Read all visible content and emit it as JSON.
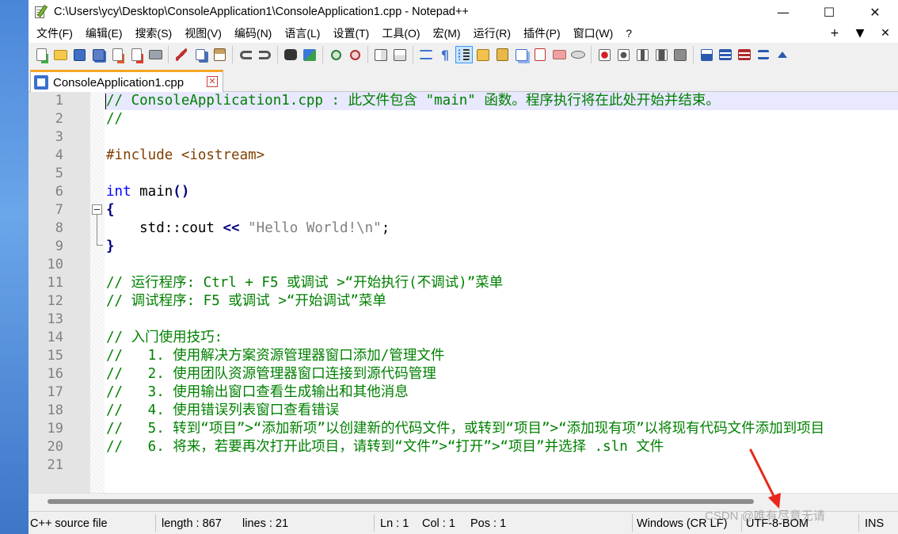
{
  "window": {
    "title": "C:\\Users\\ycy\\Desktop\\ConsoleApplication1\\ConsoleApplication1.cpp - Notepad++",
    "minimize": "—",
    "maximize": "☐",
    "close": "✕"
  },
  "menu": {
    "items": [
      "文件(F)",
      "编辑(E)",
      "搜索(S)",
      "视图(V)",
      "编码(N)",
      "语言(L)",
      "设置(T)",
      "工具(O)",
      "宏(M)",
      "运行(R)",
      "插件(P)",
      "窗口(W)",
      "?"
    ],
    "right": [
      "+",
      "▼",
      "✕"
    ]
  },
  "tab": {
    "label": "ConsoleApplication1.cpp",
    "close": "✕"
  },
  "editor": {
    "line_numbers": [
      "1",
      "2",
      "3",
      "4",
      "5",
      "6",
      "7",
      "8",
      "9",
      "10",
      "11",
      "12",
      "13",
      "14",
      "15",
      "16",
      "17",
      "18",
      "19",
      "20",
      "21"
    ],
    "lines": {
      "l1": "// ConsoleApplication1.cpp : 此文件包含 \"main\" 函数。程序执行将在此处开始并结束。",
      "l2": "//",
      "l4": "#include <iostream>",
      "l6_kw": "int",
      "l6_rest": " main",
      "l6_paren": "()",
      "l7": "{",
      "l8_a": "    std::cout ",
      "l8_op": "<<",
      "l8_str": " \"Hello World!\\n\"",
      "l8_end": ";",
      "l9": "}",
      "l11": "// 运行程序: Ctrl + F5 或调试 >“开始执行(不调试)”菜单",
      "l12": "// 调试程序: F5 或调试 >“开始调试”菜单",
      "l14": "// 入门使用技巧:",
      "l15": "//   1. 使用解决方案资源管理器窗口添加/管理文件",
      "l16": "//   2. 使用团队资源管理器窗口连接到源代码管理",
      "l17": "//   3. 使用输出窗口查看生成输出和其他消息",
      "l18": "//   4. 使用错误列表窗口查看错误",
      "l19": "//   5. 转到“项目”>“添加新项”以创建新的代码文件，或转到“项目”>“添加现有项”以将现有代码文件添加到项目",
      "l20": "//   6. 将来，若要再次打开此项目，请转到“文件”>“打开”>“项目”并选择 .sln 文件"
    }
  },
  "status": {
    "language": "C++ source file",
    "length": "length : 867",
    "lines": "lines : 21",
    "ln": "Ln : 1",
    "col": "Col : 1",
    "pos": "Pos : 1",
    "eol": "Windows (CR LF)",
    "encoding": "UTF-8-BOM",
    "mode": "INS"
  },
  "watermark": "CSDN @唯有尽意无请",
  "colors": {
    "comment": "#008000",
    "keyword": "#0000ff",
    "preprocessor": "#804000",
    "string": "#808080",
    "operator": "#000080",
    "current_line": "#e8e8ff",
    "tab_accent": "#f6a623",
    "arrow": "#e8271c"
  }
}
